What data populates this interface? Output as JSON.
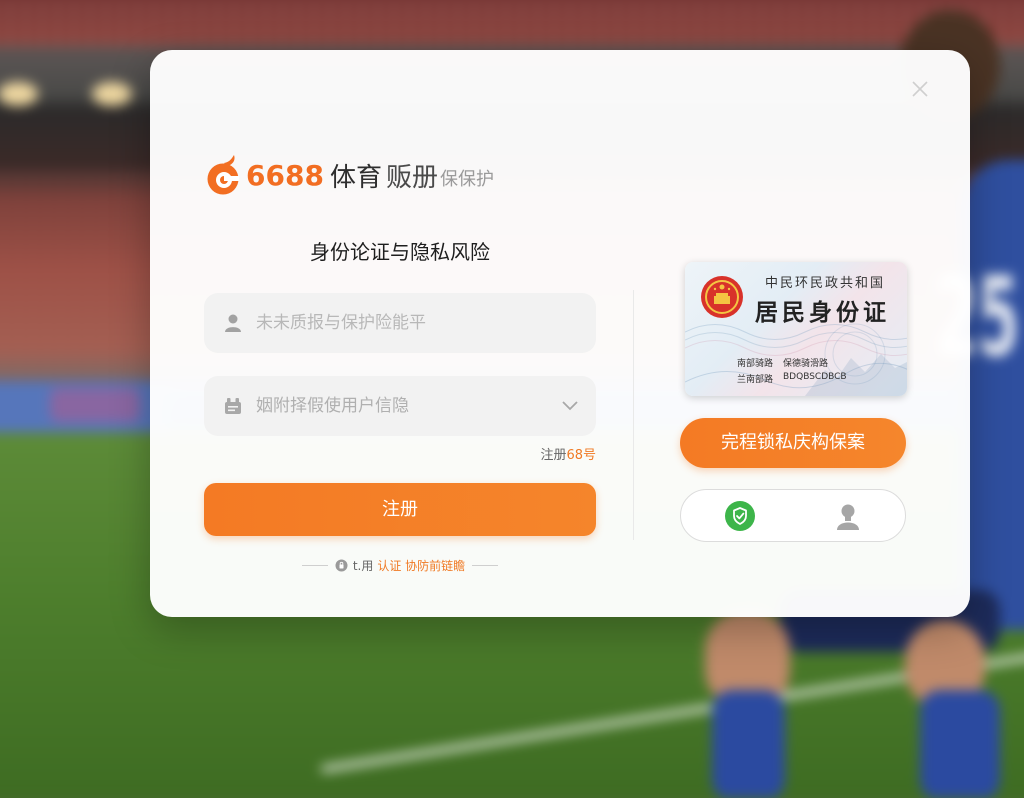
{
  "background": {
    "jersey_number": "25"
  },
  "modal": {
    "close_icon": "close-icon"
  },
  "logo": {
    "icon": "logo-icon",
    "number": "6688",
    "name": "体育",
    "name2": "贩册",
    "tagline": "保保护"
  },
  "form": {
    "title": "身份论证与隐私风险",
    "account_input": {
      "icon": "user-icon",
      "value": "",
      "placeholder": "未未质报与保护险能平"
    },
    "info_select": {
      "icon": "id-badge-icon",
      "value": "姻附择假使用户信隐",
      "dropdown_icon": "chevron-down-icon"
    },
    "register_hint": {
      "prefix": "注册",
      "highlight": "68号"
    },
    "submit_label": "注册",
    "footer": {
      "icon": "lock-icon",
      "prefix": "t.用",
      "link": "认证 协防前链瞻"
    }
  },
  "side": {
    "id_card": {
      "emblem_icon": "national-emblem-icon",
      "country": "中民环民政共和国",
      "title": "居民身份证",
      "rows": [
        {
          "label": "南部骑路",
          "value": "保德骑滑路"
        },
        {
          "label": "兰南部路",
          "value": "BDQBSCDBCB"
        }
      ]
    },
    "primary_button": "完程锁私庆构保案",
    "verify_options": [
      {
        "icon": "shield-check-icon",
        "active": true
      },
      {
        "icon": "person-icon",
        "active": false
      }
    ]
  },
  "colors": {
    "accent": "#F47A24",
    "success": "#3DB54A",
    "text": "#1E1E1E",
    "muted": "#B0B0B0",
    "field_bg": "#F2F2F2"
  }
}
